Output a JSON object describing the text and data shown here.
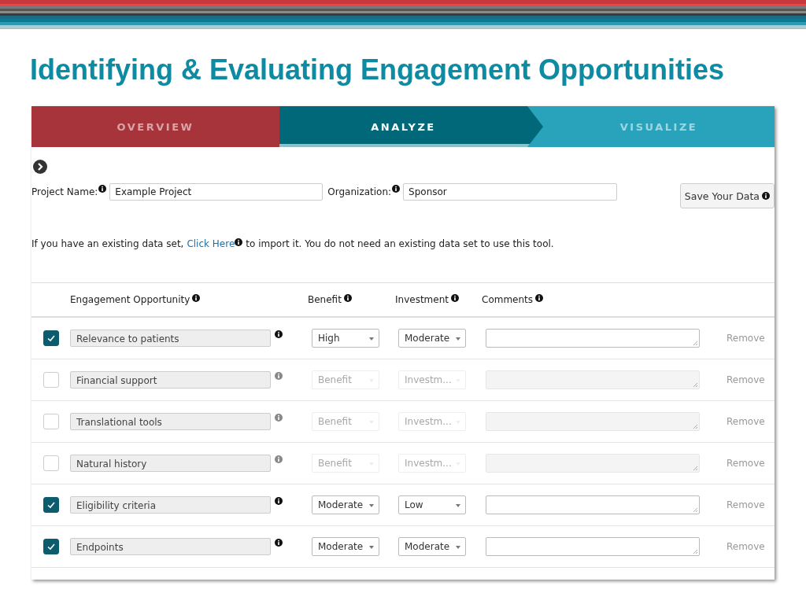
{
  "title": "Identifying & Evaluating Engagement Opportunities",
  "tabs": [
    {
      "label": "OVERVIEW",
      "selected": false,
      "color": "#a6343a"
    },
    {
      "label": "ANALYZE",
      "selected": true,
      "color": "#006878"
    },
    {
      "label": "VISUALIZE",
      "selected": false,
      "color": "#29a3bb"
    }
  ],
  "project_name": {
    "label": "Project Name:",
    "value": "Example Project"
  },
  "organization": {
    "label": "Organization:",
    "value": "Sponsor"
  },
  "save_button": "Save Your Data",
  "import_note": {
    "before": "If you have an existing data set,",
    "link": "Click Here",
    "after": "to import it. You do not need an existing data set to use this tool."
  },
  "table": {
    "columns": [
      "Engagement Opportunity",
      "Benefit",
      "Investment",
      "Comments"
    ],
    "rows": [
      {
        "checked": true,
        "opportunity": "Relevance to patients",
        "benefit": "High",
        "investment": "Moderate",
        "action": "Remove"
      },
      {
        "checked": false,
        "opportunity": "Financial support",
        "benefit": "Benefit",
        "investment": "Investm...",
        "action": "Remove"
      },
      {
        "checked": false,
        "opportunity": "Translational tools",
        "benefit": "Benefit",
        "investment": "Investm...",
        "action": "Remove"
      },
      {
        "checked": false,
        "opportunity": "Natural history",
        "benefit": "Benefit",
        "investment": "Investm...",
        "action": "Remove"
      },
      {
        "checked": true,
        "opportunity": "Eligibility criteria",
        "benefit": "Moderate",
        "investment": "Low",
        "action": "Remove"
      },
      {
        "checked": true,
        "opportunity": "Endpoints",
        "benefit": "Moderate",
        "investment": "Moderate",
        "action": "Remove"
      }
    ]
  }
}
